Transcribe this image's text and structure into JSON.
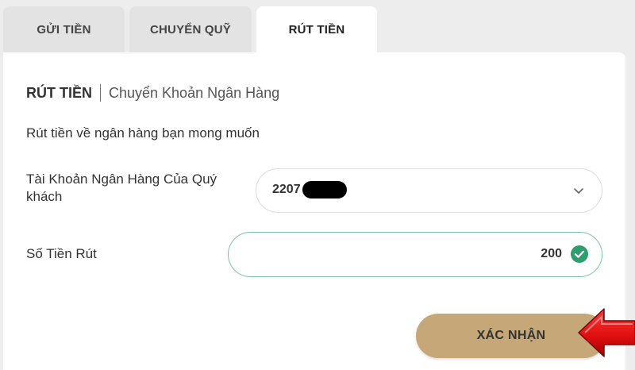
{
  "tabs": [
    {
      "label": "GỬI TIỀN"
    },
    {
      "label": "CHUYỂN QUỸ"
    },
    {
      "label": "RÚT TIỀN"
    }
  ],
  "section": {
    "title": "RÚT TIỀN",
    "subtitle": "Chuyển Khoản Ngân Hàng"
  },
  "description": "Rút tiền về ngân hàng bạn mong muốn",
  "bank_account": {
    "label": "Tài Khoản Ngân Hàng Của Quý khách",
    "value": "2207"
  },
  "amount": {
    "label": "Số Tiền Rút",
    "value": "200"
  },
  "confirm": {
    "label": "XÁC NHẬN"
  },
  "colors": {
    "accent_gold": "#c6a778",
    "valid_green": "#2e9e6e",
    "arrow_red": "#e01010"
  }
}
